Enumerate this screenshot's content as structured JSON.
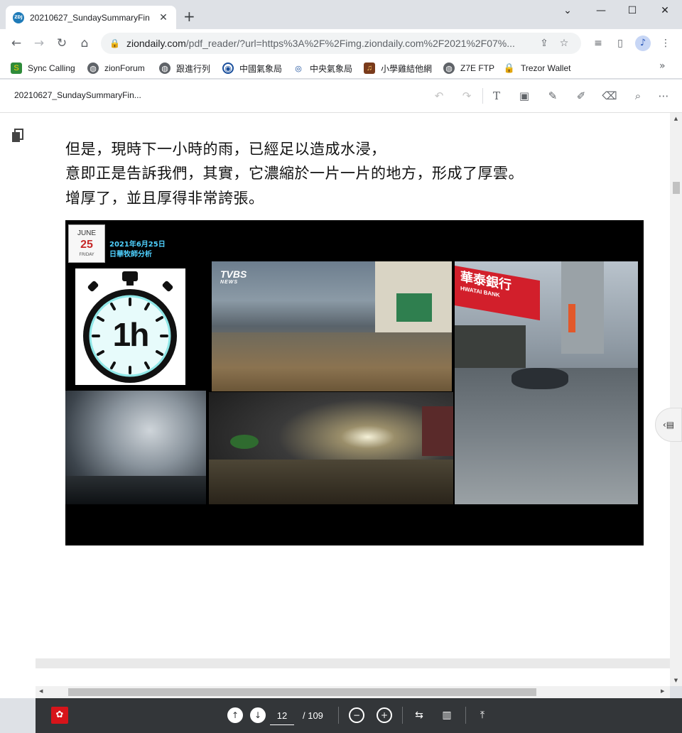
{
  "browser": {
    "tab": {
      "favicon_text": "ZDJ",
      "title": "20210627_SundaySummaryFin",
      "close": "✕"
    },
    "new_tab": "+",
    "window": {
      "minimize": "⌄",
      "restore": "—",
      "maximize": "☐",
      "close": "✕"
    },
    "omnibox": {
      "host": "ziondaily.com",
      "path": "/pdf_reader/?url=https%3A%2F%2Fimg.ziondaily.com%2F2021%2F07%..."
    },
    "bookmarks": [
      {
        "label": "Sync Calling",
        "icon": "sync-calling-icon"
      },
      {
        "label": "zionForum",
        "icon": "globe-icon"
      },
      {
        "label": "跟進行列",
        "icon": "globe-icon"
      },
      {
        "label": "中國氣象局",
        "icon": "weather-bureau-icon"
      },
      {
        "label": "中央氣象局",
        "icon": "cwb-icon"
      },
      {
        "label": "小學雞結他網",
        "icon": "guitar-icon"
      },
      {
        "label": "Z7E FTP",
        "icon": "globe-icon"
      },
      {
        "label": "Trezor Wallet",
        "icon": "lock-icon"
      }
    ],
    "bookmarks_more": "»"
  },
  "pdf": {
    "doc_name": "20210627_SundaySummaryFin...",
    "text_lines": [
      "但是，現時下一小時的雨，已經足以造成水浸，",
      "意即正是告訴我們，其實，它濃縮於一片一片的地方，形成了厚雲。",
      "增厚了，並且厚得非常誇張。"
    ],
    "image": {
      "calendar_month": "JUNE",
      "calendar_day": "25",
      "calendar_weekday": "FRIDAY",
      "caption_date": "2021年6月25日",
      "caption_author": "日華牧師分析",
      "clock_label": "1h",
      "news_logo": "TVBS",
      "news_logo_sub": "NEWS",
      "bank_sign_cn": "華泰銀行",
      "bank_sign_en": "HWATAI BANK"
    },
    "current_page": "12",
    "total_pages": "/ 109"
  },
  "colors": {
    "acrobat_red": "#d7141a",
    "bottom_bar": "#333639",
    "caption_cyan": "#4fd1ff",
    "bank_red": "#d21f2b"
  }
}
